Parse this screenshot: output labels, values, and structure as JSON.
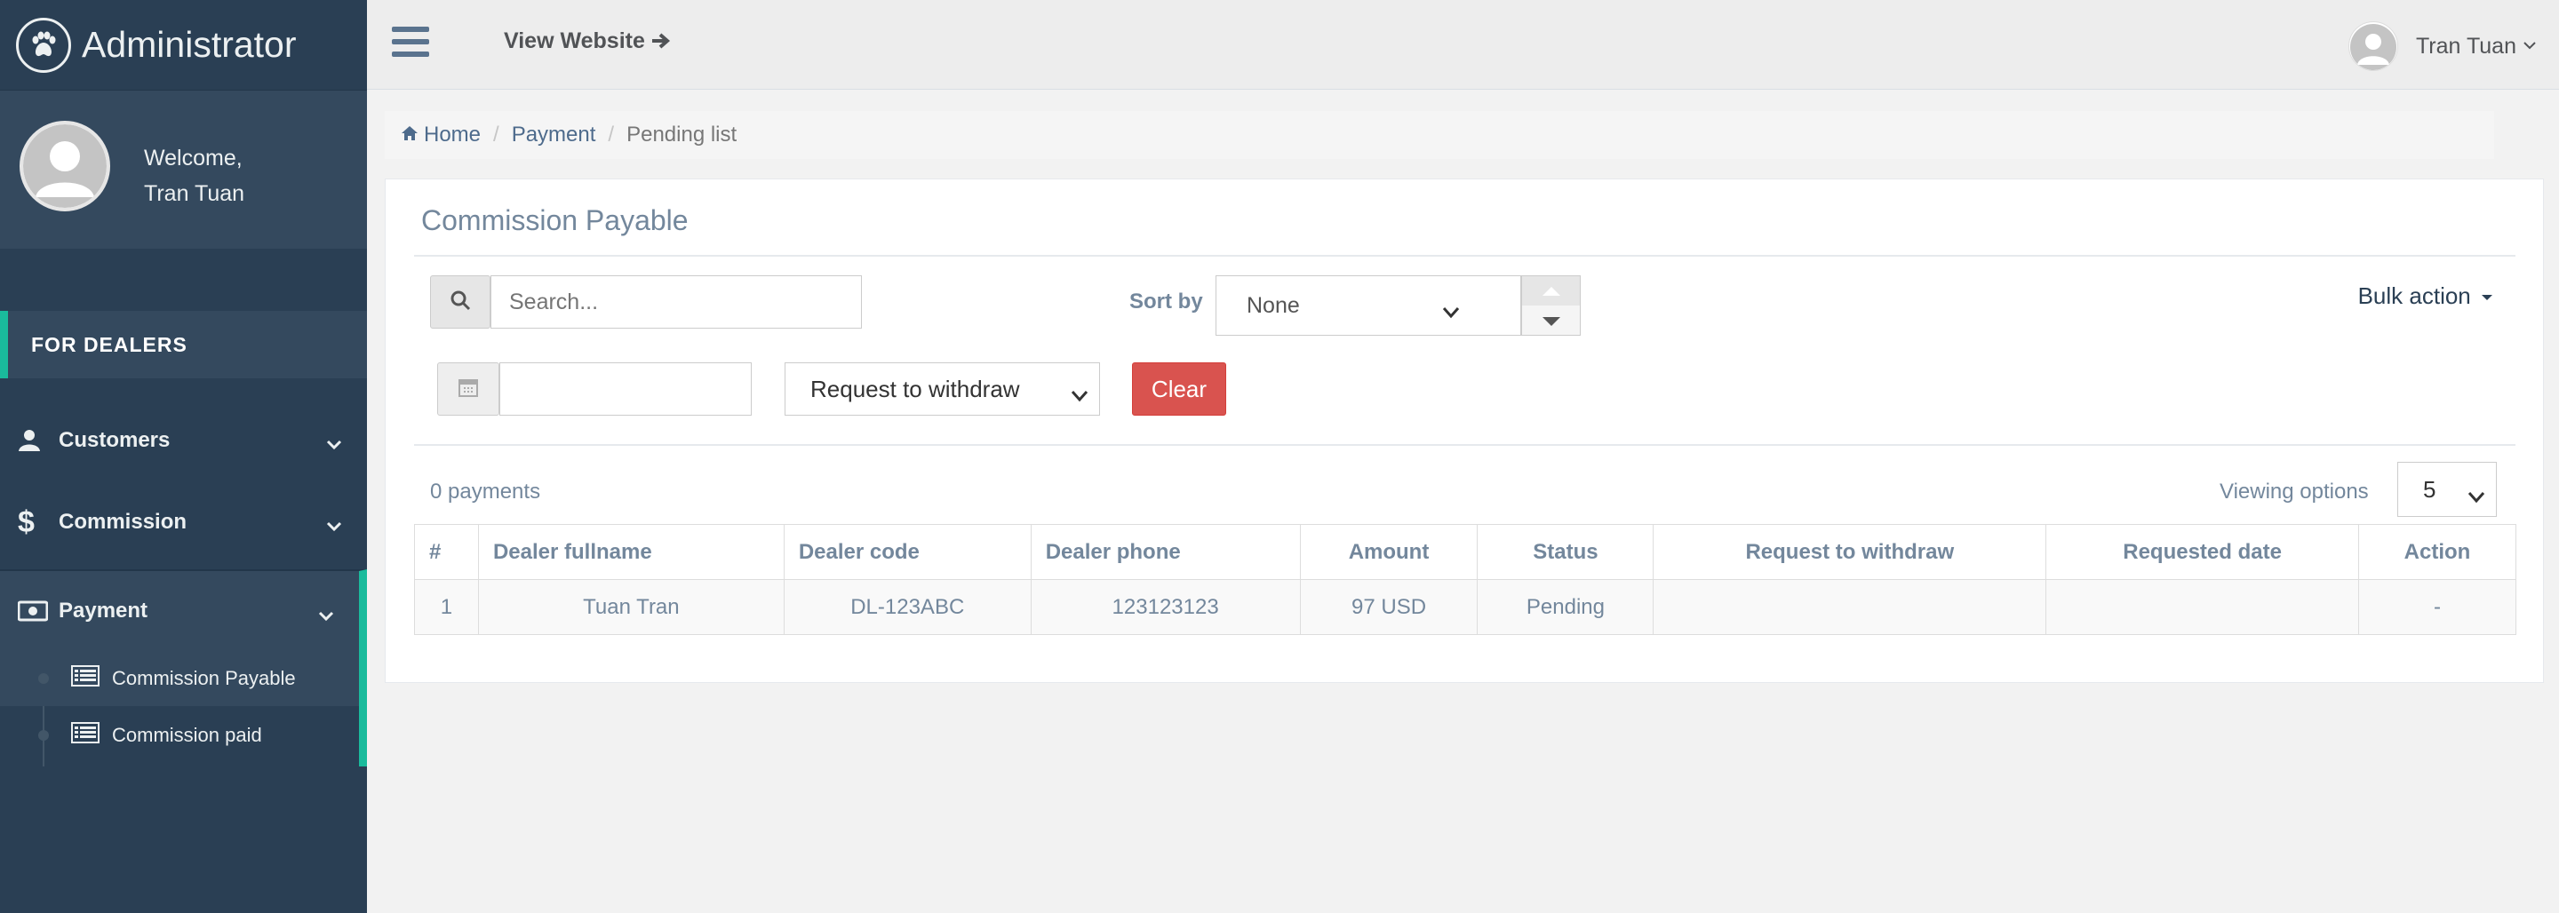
{
  "brand": {
    "title": "Administrator"
  },
  "profile": {
    "welcome": "Welcome,",
    "name": "Tran Tuan"
  },
  "sidebar": {
    "section": "FOR DEALERS",
    "items": [
      {
        "label": "Customers",
        "icon": "user-icon"
      },
      {
        "label": "Commission",
        "icon": "dollar-icon"
      },
      {
        "label": "Payment",
        "icon": "money-icon"
      }
    ],
    "payment_subitems": [
      {
        "label": "Commission Payable",
        "icon": "list-icon"
      },
      {
        "label": "Commission paid",
        "icon": "list-icon"
      }
    ]
  },
  "topnav": {
    "view_website": "View Website",
    "user_name": "Tran Tuan"
  },
  "breadcrumb": {
    "home": "Home",
    "payment": "Payment",
    "current": "Pending list"
  },
  "panel": {
    "title": "Commission Payable",
    "search_placeholder": "Search...",
    "sort_label": "Sort by",
    "sort_value": "None",
    "bulk_action": "Bulk action",
    "date_value": "",
    "withdraw_filter": "Request to withdraw",
    "clear_label": "Clear",
    "count_text": "0 payments",
    "viewing_label": "Viewing options",
    "viewing_value": "5"
  },
  "table": {
    "headers": [
      "#",
      "Dealer fullname",
      "Dealer code",
      "Dealer phone",
      "Amount",
      "Status",
      "Request to withdraw",
      "Requested date",
      "Action"
    ],
    "rows": [
      {
        "index": "1",
        "fullname": "Tuan Tran",
        "code": "DL-123ABC",
        "phone": "123123123",
        "amount": "97 USD",
        "status": "Pending",
        "request": "",
        "requested_date": "",
        "action": "-"
      }
    ]
  },
  "colors": {
    "sidebar_bg": "#2a3f54",
    "accent": "#1abb9c",
    "danger": "#d9534f"
  }
}
